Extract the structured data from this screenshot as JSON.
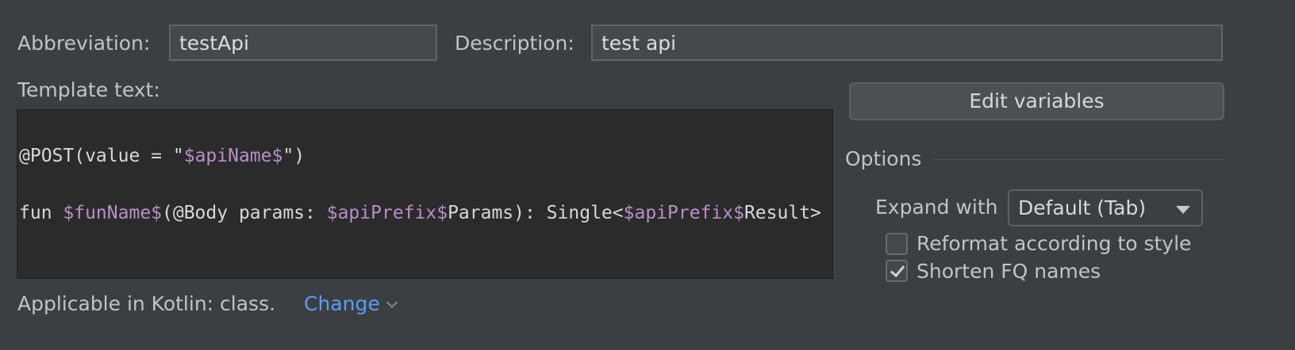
{
  "abbreviation": {
    "label": "Abbreviation:",
    "value": "testApi"
  },
  "description": {
    "label": "Description:",
    "value": "test api"
  },
  "template": {
    "label": "Template text:",
    "line1": {
      "p1": "@POST(value = \"",
      "v1": "$apiName$",
      "p2": "\")"
    },
    "line2": {
      "p1": "fun ",
      "v1": "$funName$",
      "p2": "(@Body params: ",
      "v2": "$apiPrefix$",
      "p3": "Params): Single<",
      "v3": "$apiPrefix$",
      "p4": "Result>"
    }
  },
  "edit_variables_label": "Edit variables",
  "options": {
    "title": "Options",
    "expand_label": "Expand with",
    "expand_value": "Default (Tab)",
    "reformat": {
      "label": "Reformat according to style",
      "checked": false
    },
    "shorten": {
      "label": "Shorten FQ names",
      "checked": true
    }
  },
  "footer": {
    "context_text": "Applicable in Kotlin: class.",
    "change_label": "Change"
  },
  "colors": {
    "variable": "#b88fc9",
    "link": "#589df6",
    "background": "#3c3f41",
    "editor_bg": "#2b2b2b"
  },
  "icons": [
    "chevron-down-icon",
    "dropdown-arrow-icon",
    "checkmark-icon"
  ]
}
